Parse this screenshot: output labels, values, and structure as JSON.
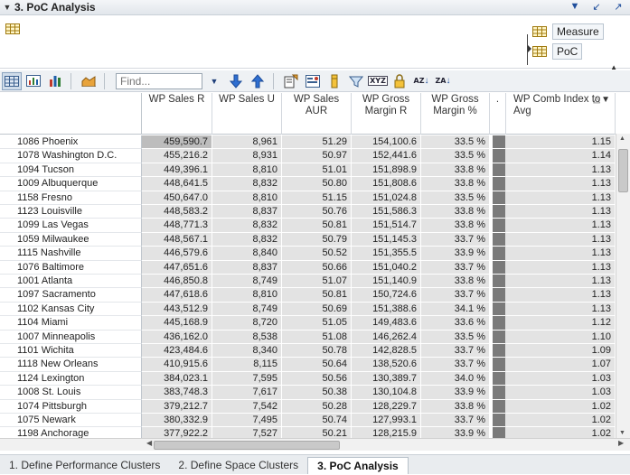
{
  "window": {
    "title": "3. PoC Analysis"
  },
  "pivot": {
    "chips": [
      {
        "label": "Measure"
      },
      {
        "label": "PoC"
      }
    ]
  },
  "toolbar": {
    "find_placeholder": "Find...",
    "xyz_label": "XYZ",
    "az_label": "AZ",
    "za_label": "ZA"
  },
  "table": {
    "columns": [
      {
        "label": "WP Sales R"
      },
      {
        "label": "WP Sales U"
      },
      {
        "label": "WP Sales AUR"
      },
      {
        "label": "WP Gross Margin R"
      },
      {
        "label": "WP Gross Margin %"
      },
      {
        "label": "."
      },
      {
        "label": "WP Comb Index to Avg"
      }
    ],
    "rows": [
      {
        "name": "1086 Phoenix",
        "sales_r": "459,590.7",
        "sales_u": "8,961",
        "aur": "51.29",
        "gm_r": "154,100.6",
        "gm_pct": "33.5 %",
        "idx": "1.15"
      },
      {
        "name": "1078 Washington D.C.",
        "sales_r": "455,216.2",
        "sales_u": "8,931",
        "aur": "50.97",
        "gm_r": "152,441.6",
        "gm_pct": "33.5 %",
        "idx": "1.14"
      },
      {
        "name": "1094 Tucson",
        "sales_r": "449,396.1",
        "sales_u": "8,810",
        "aur": "51.01",
        "gm_r": "151,898.9",
        "gm_pct": "33.8 %",
        "idx": "1.13"
      },
      {
        "name": "1009 Albuquerque",
        "sales_r": "448,641.5",
        "sales_u": "8,832",
        "aur": "50.80",
        "gm_r": "151,808.6",
        "gm_pct": "33.8 %",
        "idx": "1.13"
      },
      {
        "name": "1158 Fresno",
        "sales_r": "450,647.0",
        "sales_u": "8,810",
        "aur": "51.15",
        "gm_r": "151,024.8",
        "gm_pct": "33.5 %",
        "idx": "1.13"
      },
      {
        "name": "1123 Louisville",
        "sales_r": "448,583.2",
        "sales_u": "8,837",
        "aur": "50.76",
        "gm_r": "151,586.3",
        "gm_pct": "33.8 %",
        "idx": "1.13"
      },
      {
        "name": "1099 Las Vegas",
        "sales_r": "448,771.3",
        "sales_u": "8,832",
        "aur": "50.81",
        "gm_r": "151,514.7",
        "gm_pct": "33.8 %",
        "idx": "1.13"
      },
      {
        "name": "1059 Milwaukee",
        "sales_r": "448,567.1",
        "sales_u": "8,832",
        "aur": "50.79",
        "gm_r": "151,145.3",
        "gm_pct": "33.7 %",
        "idx": "1.13"
      },
      {
        "name": "1115 Nashville",
        "sales_r": "446,579.6",
        "sales_u": "8,840",
        "aur": "50.52",
        "gm_r": "151,355.5",
        "gm_pct": "33.9 %",
        "idx": "1.13"
      },
      {
        "name": "1076 Baltimore",
        "sales_r": "447,651.6",
        "sales_u": "8,837",
        "aur": "50.66",
        "gm_r": "151,040.2",
        "gm_pct": "33.7 %",
        "idx": "1.13"
      },
      {
        "name": "1001 Atlanta",
        "sales_r": "446,850.8",
        "sales_u": "8,749",
        "aur": "51.07",
        "gm_r": "151,140.9",
        "gm_pct": "33.8 %",
        "idx": "1.13"
      },
      {
        "name": "1097 Sacramento",
        "sales_r": "447,618.6",
        "sales_u": "8,810",
        "aur": "50.81",
        "gm_r": "150,724.6",
        "gm_pct": "33.7 %",
        "idx": "1.13"
      },
      {
        "name": "1102 Kansas City",
        "sales_r": "443,512.9",
        "sales_u": "8,749",
        "aur": "50.69",
        "gm_r": "151,388.6",
        "gm_pct": "34.1 %",
        "idx": "1.13"
      },
      {
        "name": "1104 Miami",
        "sales_r": "445,168.9",
        "sales_u": "8,720",
        "aur": "51.05",
        "gm_r": "149,483.6",
        "gm_pct": "33.6 %",
        "idx": "1.12"
      },
      {
        "name": "1007 Minneapolis",
        "sales_r": "436,162.0",
        "sales_u": "8,538",
        "aur": "51.08",
        "gm_r": "146,262.4",
        "gm_pct": "33.5 %",
        "idx": "1.10"
      },
      {
        "name": "1101 Wichita",
        "sales_r": "423,484.6",
        "sales_u": "8,340",
        "aur": "50.78",
        "gm_r": "142,828.5",
        "gm_pct": "33.7 %",
        "idx": "1.09"
      },
      {
        "name": "1118 New Orleans",
        "sales_r": "410,915.6",
        "sales_u": "8,115",
        "aur": "50.64",
        "gm_r": "138,520.6",
        "gm_pct": "33.7 %",
        "idx": "1.07"
      },
      {
        "name": "1124 Lexington",
        "sales_r": "384,023.1",
        "sales_u": "7,595",
        "aur": "50.56",
        "gm_r": "130,389.7",
        "gm_pct": "34.0 %",
        "idx": "1.03"
      },
      {
        "name": "1008 St. Louis",
        "sales_r": "383,748.3",
        "sales_u": "7,617",
        "aur": "50.38",
        "gm_r": "130,104.8",
        "gm_pct": "33.9 %",
        "idx": "1.03"
      },
      {
        "name": "1074 Pittsburgh",
        "sales_r": "379,212.7",
        "sales_u": "7,542",
        "aur": "50.28",
        "gm_r": "128,229.7",
        "gm_pct": "33.8 %",
        "idx": "1.02"
      },
      {
        "name": "1075 Newark",
        "sales_r": "380,332.9",
        "sales_u": "7,495",
        "aur": "50.74",
        "gm_r": "127,993.1",
        "gm_pct": "33.7 %",
        "idx": "1.02"
      },
      {
        "name": "1198 Anchorage",
        "sales_r": "377,922.2",
        "sales_u": "7,527",
        "aur": "50.21",
        "gm_r": "128,215.9",
        "gm_pct": "33.9 %",
        "idx": "1.02"
      }
    ]
  },
  "tabs": [
    {
      "label": "1. Define Performance Clusters"
    },
    {
      "label": "2. Define Space Clusters"
    },
    {
      "label": "3. PoC Analysis"
    }
  ]
}
